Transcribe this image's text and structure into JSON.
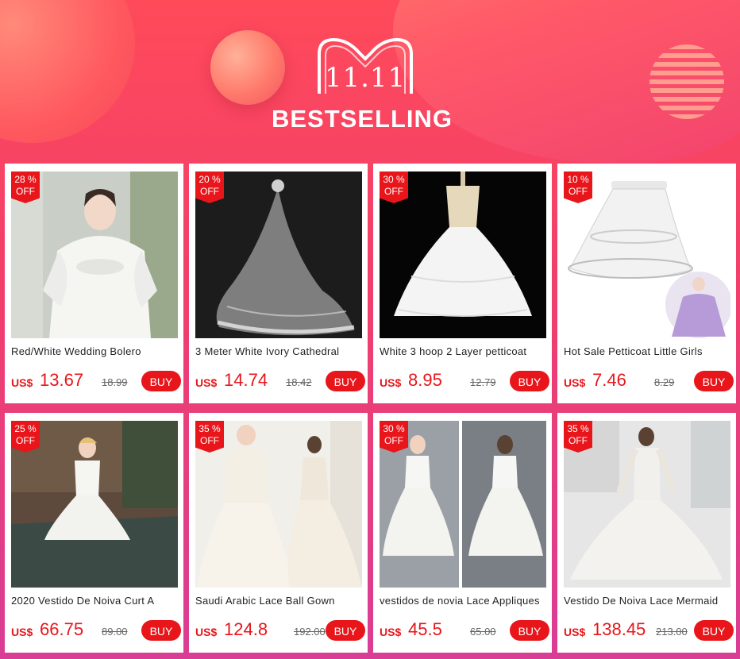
{
  "banner": {
    "event": "11.11",
    "headline": "BESTSELLING"
  },
  "colors": {
    "accent": "#e8161b",
    "background_top": "#ff4a5a",
    "background_bottom": "#d93d95"
  },
  "products": [
    {
      "discount": "28 %",
      "off": "OFF",
      "title": "Red/White Wedding Bolero",
      "currency": "US$",
      "price": "13.67",
      "old_price": "18.99",
      "buy": "BUY"
    },
    {
      "discount": "20 %",
      "off": "OFF",
      "title": "3 Meter White Ivory Cathedral",
      "currency": "US$",
      "price": "14.74",
      "old_price": "18.42",
      "buy": "BUY"
    },
    {
      "discount": "30 %",
      "off": "OFF",
      "title": "White 3 hoop 2 Layer petticoat",
      "currency": "US$",
      "price": "8.95",
      "old_price": "12.79",
      "buy": "BUY"
    },
    {
      "discount": "10 %",
      "off": "OFF",
      "title": "Hot Sale Petticoat Little Girls",
      "currency": "US$",
      "price": "7.46",
      "old_price": "8.29",
      "buy": "BUY"
    },
    {
      "discount": "25 %",
      "off": "OFF",
      "title": "2020 Vestido De Noiva Curt A",
      "currency": "US$",
      "price": "66.75",
      "old_price": "89.00",
      "buy": "BUY"
    },
    {
      "discount": "35 %",
      "off": "OFF",
      "title": "Saudi Arabic Lace Ball Gown",
      "currency": "US$",
      "price": "124.8",
      "old_price": "192.00",
      "buy": "BUY"
    },
    {
      "discount": "30 %",
      "off": "OFF",
      "title": "vestidos de novia Lace Appliques",
      "currency": "US$",
      "price": "45.5",
      "old_price": "65.00",
      "buy": "BUY"
    },
    {
      "discount": "35 %",
      "off": "OFF",
      "title": "Vestido De Noiva Lace Mermaid",
      "currency": "US$",
      "price": "138.45",
      "old_price": "213.00",
      "buy": "BUY"
    }
  ]
}
